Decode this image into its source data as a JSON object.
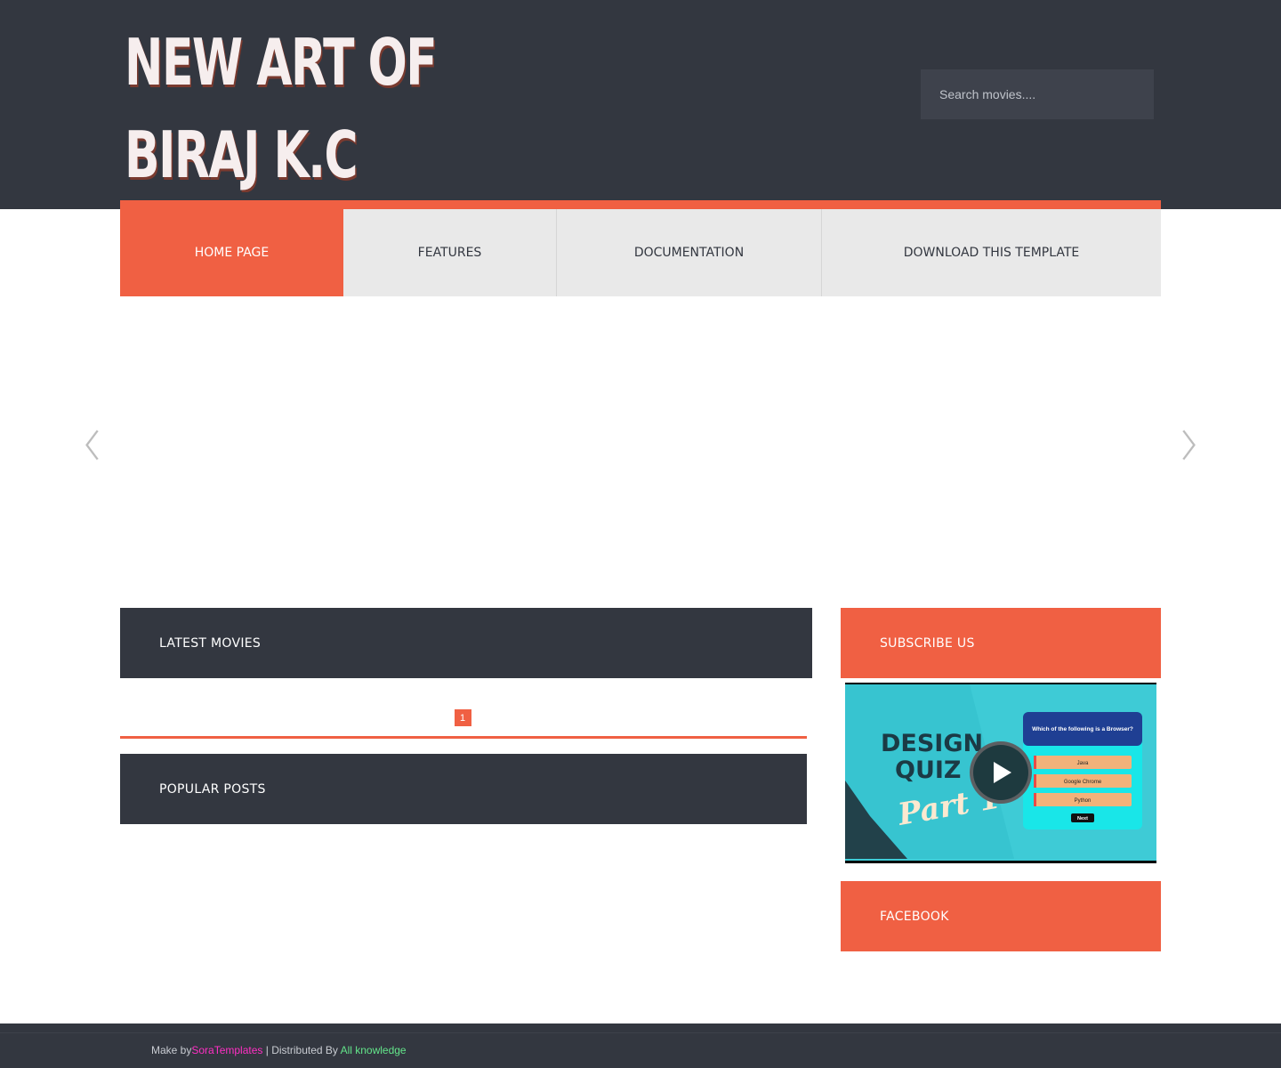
{
  "header": {
    "title_line1": "NEW ART OF",
    "title_line2": "BIRAJ K.C",
    "search_placeholder": "Search movies...."
  },
  "nav": {
    "items": [
      {
        "label": "HOME PAGE",
        "active": true
      },
      {
        "label": "FEATURES",
        "active": false
      },
      {
        "label": "DOCUMENTATION",
        "active": false
      },
      {
        "label": "DOWNLOAD THIS TEMPLATE",
        "active": false
      }
    ]
  },
  "slider": {
    "prev_icon": "chevron-left-icon",
    "next_icon": "chevron-right-icon"
  },
  "main": {
    "latest_title": "LATEST MOVIES",
    "pagination": [
      "1"
    ],
    "popular_title": "POPULAR POSTS"
  },
  "sidebar": {
    "subscribe_title": "SUBSCRIBE US",
    "video": {
      "text_line1": "DESIGN",
      "text_line2": "QUIZ",
      "text_line3": "Part 1",
      "quiz_question": "Which of the following is a Browser?",
      "options": [
        "Java",
        "Google Chrome",
        "Python"
      ],
      "next_label": "Next"
    },
    "facebook_title": "FACEBOOK"
  },
  "footer": {
    "make_by": "Make by",
    "sora": "SoraTemplates",
    "distributed": " | Distributed By ",
    "allk": "All knowledge"
  },
  "colors": {
    "dark": "#333740",
    "accent": "#f06043",
    "nav_bg": "#e9e9e9",
    "video_cyan": "#3ecbd6"
  }
}
